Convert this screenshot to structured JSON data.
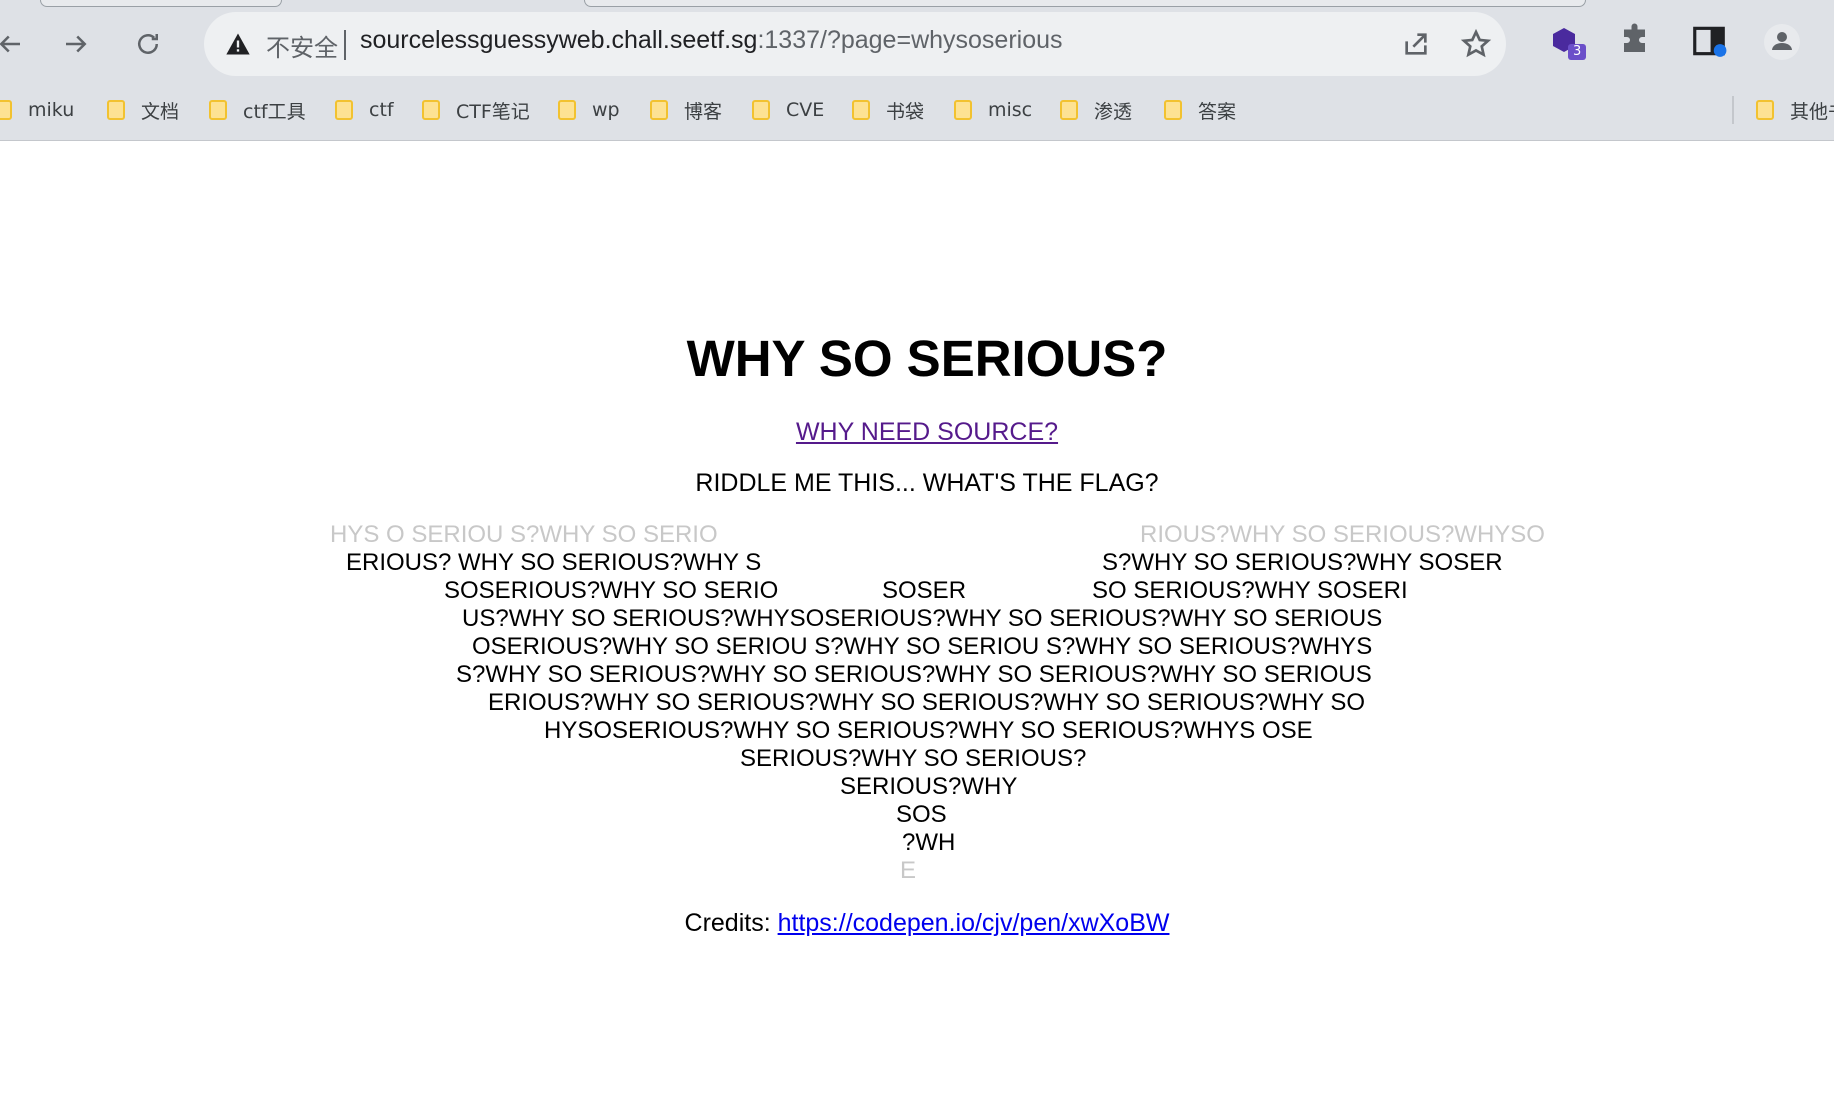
{
  "browser": {
    "insecure_label": "不安全",
    "url_host": "sourcelessguessyweb.chall.seetf.sg",
    "url_rest": ":1337/?page=whysoserious",
    "extension_badge": "3"
  },
  "bookmarks": [
    {
      "label": "miku"
    },
    {
      "label": "文档"
    },
    {
      "label": "ctf工具"
    },
    {
      "label": "ctf"
    },
    {
      "label": "CTF笔记"
    },
    {
      "label": "wp"
    },
    {
      "label": "博客"
    },
    {
      "label": "CVE"
    },
    {
      "label": "书袋"
    },
    {
      "label": "misc"
    },
    {
      "label": "渗透"
    },
    {
      "label": "答案"
    },
    {
      "label": "其他书"
    }
  ],
  "page": {
    "title": "WHY SO SERIOUS?",
    "source_link": "WHY NEED SOURCE?",
    "riddle": "RIDDLE ME THIS... WHAT'S THE FLAG?",
    "credits_label": "Credits:",
    "credits_link": "https://codepen.io/cjv/pen/xwXoBW"
  },
  "bat_lines": [
    "HYS O SERIOU S?WHY SO SERIO",
    "RIOUS?WHY SO SERIOUS?WHYSO",
    "ERIOUS? WHY SO SERIOUS?WHY S",
    "S?WHY SO SERIOUS?WHY SOSER",
    "SOSERIOUS?WHY SO SERIO",
    "SOSER",
    "SO SERIOUS?WHY SOSERI",
    "US?WHY SO SERIOUS?WHYSOSERIOUS?WHY SO SERIOUS?WHY SO SERIOUS",
    "OSERIOUS?WHY SO SERIOU S?WHY SO SERIOU S?WHY SO SERIOUS?WHYS",
    "S?WHY SO SERIOUS?WHY SO SERIOUS?WHY SO SERIOUS?WHY SO SERIOUS",
    "ERIOUS?WHY SO SERIOUS?WHY SO SERIOUS?WHY SO SERIOUS?WHY SO",
    "HYSOSERIOUS?WHY SO SERIOUS?WHY SO SERIOUS?WHYS OSE",
    "SERIOUS?WHY SO SERIOUS?",
    "SERIOUS?WHY",
    "SOS",
    "?WH",
    "E"
  ]
}
